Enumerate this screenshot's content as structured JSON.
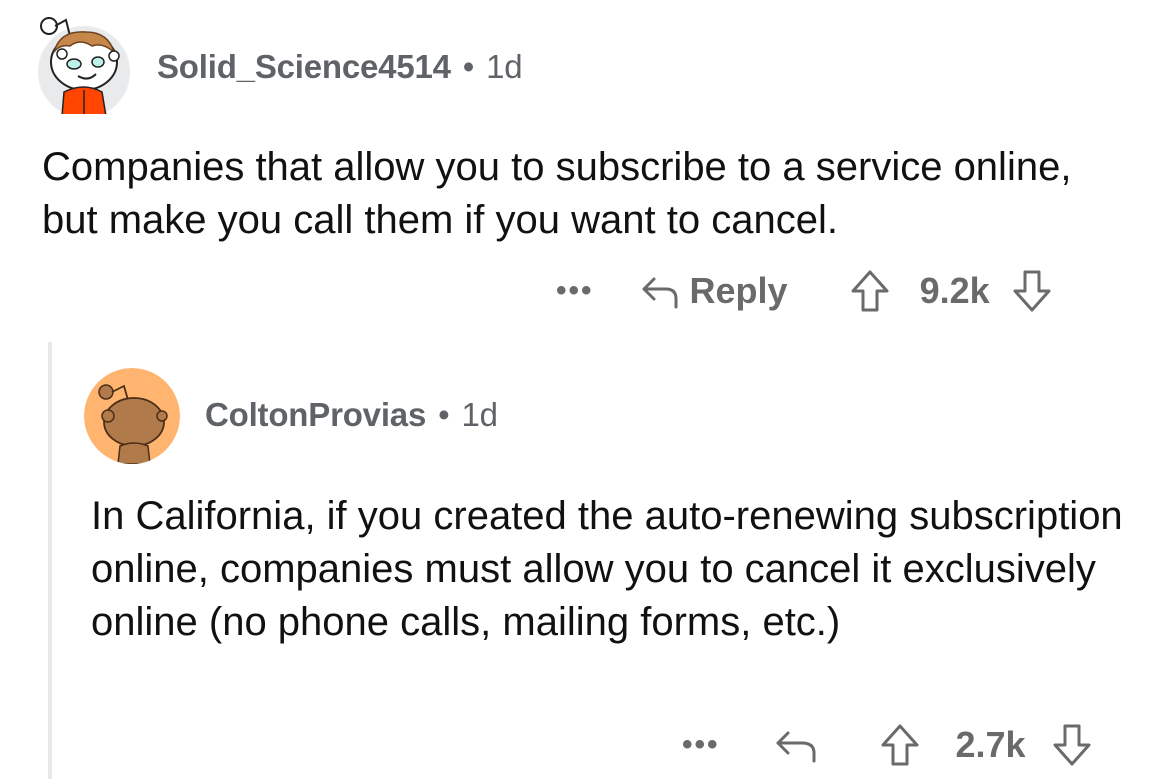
{
  "comments": [
    {
      "username": "Solid_Science4514",
      "separator": "•",
      "age": "1d",
      "body": "Companies that allow you to subscribe to a service online, but make you call them if you want to cancel.",
      "actions": {
        "more_label": "•••",
        "reply_label": "Reply",
        "score": "9.2k"
      },
      "avatar": {
        "bg": "#e9eaec",
        "outfit_color": "#ff4500",
        "hair_color": "#c8874a",
        "eye_color": "#bdf2ec"
      }
    },
    {
      "username": "ColtonProvias",
      "separator": "•",
      "age": "1d",
      "body": "In California, if you created the auto-renewing subscription online, companies must allow you to cancel it exclusively online (no phone calls, mailing forms, etc.)",
      "actions": {
        "more_label": "•••",
        "score": "2.7k"
      },
      "avatar": {
        "bg": "#ffb470",
        "figure_color": "#b17a4b"
      }
    }
  ]
}
